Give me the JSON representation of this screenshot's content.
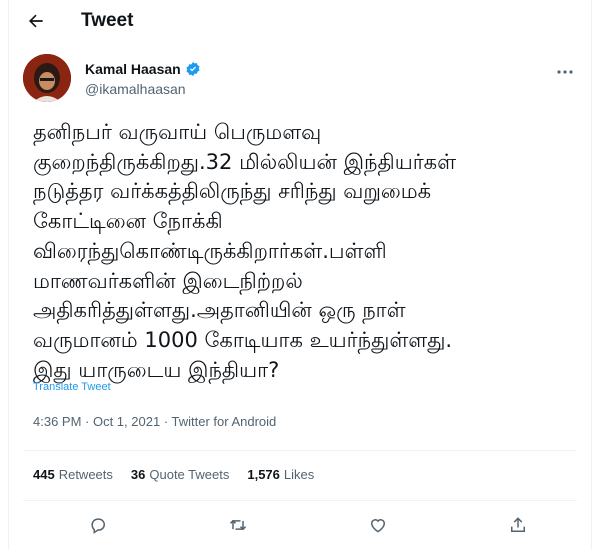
{
  "header": {
    "title": "Tweet",
    "back_icon": "arrow-left-icon"
  },
  "author": {
    "name": "Kamal Haasan",
    "handle": "@ikamalhaasan",
    "verified_icon": "verified-badge-icon",
    "verified_color": "#1d9bf0"
  },
  "tweet": {
    "text": "தனிநபர் வருவாய் பெருமளவு\nகுறைந்திருக்கிறது.32 மில்லியன் இந்தியர்கள்\nநடுத்தர வர்க்கத்திலிருந்து சரிந்து வறுமைக்\nகோட்டினை நோக்கி\nவிரைந்துகொண்டிருக்கிறார்கள்.பள்ளி\nமாணவர்களின் இடைநிற்றல்\nஅதிகரித்துள்ளது.அதானியின் ஒரு நாள்\nவருமானம் 1000 கோடியாக உயர்ந்துள்ளது.\nஇது யாருடைய இந்தியா?",
    "translate_label": "Translate Tweet",
    "timestamp": "4:36 PM · Oct 1, 2021 · Twitter for Android"
  },
  "stats": {
    "retweets_count": "445",
    "retweets_label": "Retweets",
    "quotes_count": "36",
    "quotes_label": "Quote Tweets",
    "likes_count": "1,576",
    "likes_label": "Likes"
  },
  "actions": [
    "reply-icon",
    "retweet-icon",
    "like-icon",
    "share-icon"
  ],
  "colors": {
    "accent": "#1d9bf0",
    "secondary_text": "#536471",
    "divider": "#eff3f4"
  }
}
